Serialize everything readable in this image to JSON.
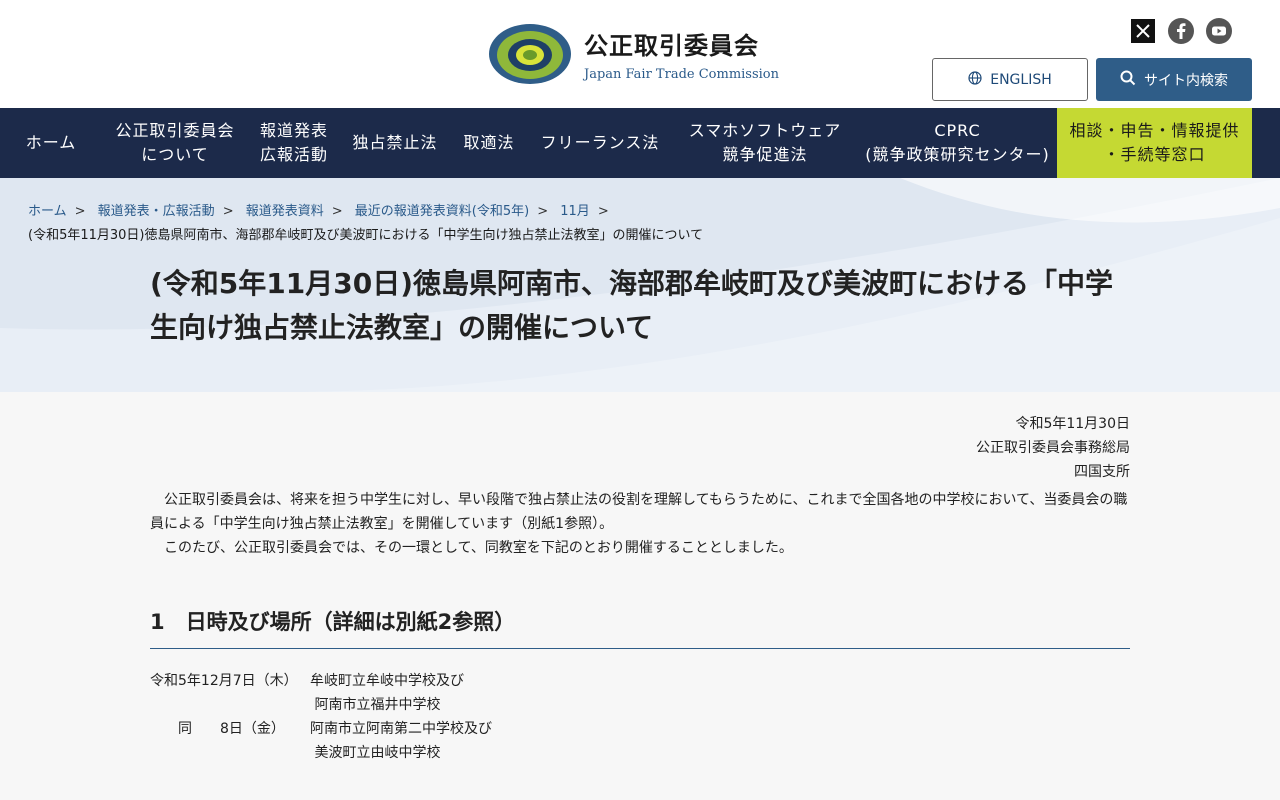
{
  "header": {
    "org_name_ja": "公正取引委員会",
    "org_name_en": "Japan Fair Trade Commission",
    "social": [
      "x-icon",
      "facebook-icon",
      "youtube-icon"
    ],
    "english_label": "ENGLISH",
    "search_label": "サイト内検索"
  },
  "nav": {
    "items": [
      {
        "line1": "ホーム",
        "line2": ""
      },
      {
        "line1": "公正取引委員会",
        "line2": "について"
      },
      {
        "line1": "報道発表",
        "line2": "広報活動"
      },
      {
        "line1": "独占禁止法",
        "line2": ""
      },
      {
        "line1": "取適法",
        "line2": ""
      },
      {
        "line1": "フリーランス法",
        "line2": ""
      },
      {
        "line1": "スマホソフトウェア",
        "line2": "競争促進法"
      },
      {
        "line1": "CPRC",
        "line2": "(競争政策研究センター)"
      },
      {
        "line1": "相談・申告・情報提供",
        "line2": "・手続等窓口"
      }
    ]
  },
  "breadcrumb": {
    "links": [
      "ホーム",
      "報道発表・広報活動",
      "報道発表資料",
      "最近の報道発表資料(令和5年)",
      "11月"
    ],
    "current": "(令和5年11月30日)徳島県阿南市、海部郡牟岐町及び美波町における「中学生向け独占禁止法教室」の開催について"
  },
  "page": {
    "title": "(令和5年11月30日)徳島県阿南市、海部郡牟岐町及び美波町における「中学生向け独占禁止法教室」の開催について",
    "date": "令和5年11月30日",
    "issuer": "公正取引委員会事務総局",
    "branch": "四国支所",
    "para1": "公正取引委員会は、将来を担う中学生に対し、早い段階で独占禁止法の役割を理解してもらうために、これまで全国各地の中学校において、当委員会の職員による「中学生向け独占禁止法教室」を開催しています（別紙1参照）。",
    "para2": "このたび、公正取引委員会では、その一環として、同教室を下記のとおり開催することとしました。",
    "section1_heading": "1　日時及び場所（詳細は別紙2参照）",
    "schedule": [
      {
        "date": "令和5年12月7日（木）",
        "place": "牟岐町立牟岐中学校及び"
      },
      {
        "date": "",
        "place": " 阿南市立福井中学校"
      },
      {
        "date": "　　同　　8日（金）",
        "place": "阿南市立阿南第二中学校及び"
      },
      {
        "date": "",
        "place": " 美波町立由岐中学校"
      }
    ]
  }
}
